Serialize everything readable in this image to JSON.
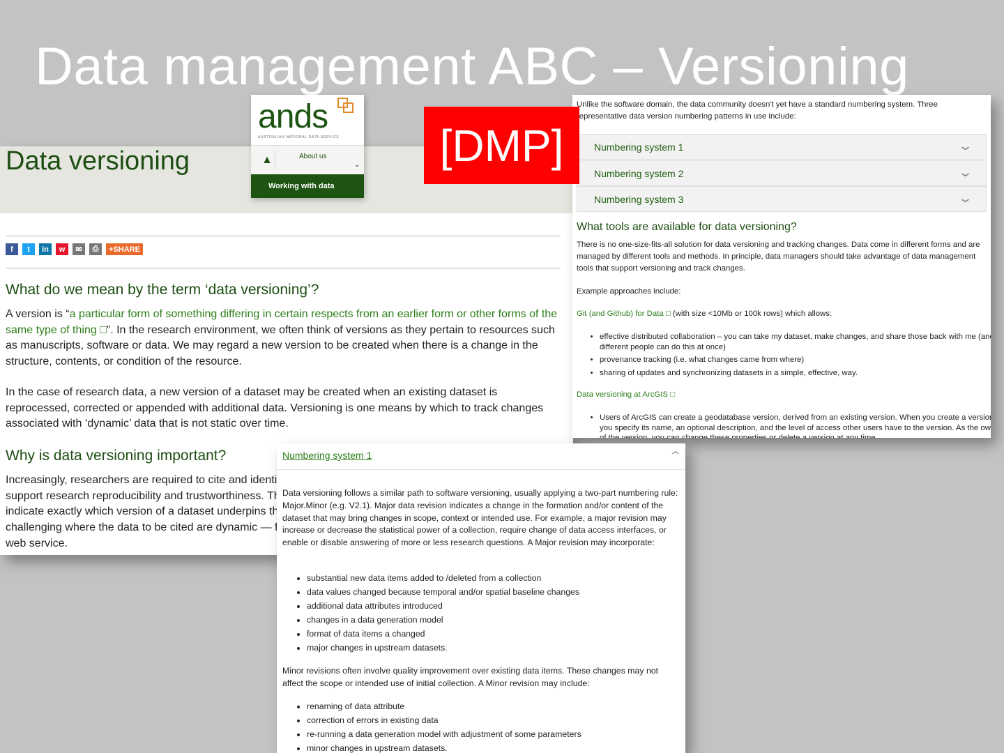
{
  "slide_title": "Data management ABC – Versioning",
  "badge": "[DMP]",
  "left_page": {
    "heading": "Data versioning",
    "share_icons": [
      "facebook-icon",
      "twitter-icon",
      "linkedin-icon",
      "weibo-icon",
      "email-icon",
      "print-icon"
    ],
    "share_label": "SHARE",
    "share_plus": "+",
    "q1": "What do we mean by the term ‘data versioning’?",
    "p1_lead": "A version is “",
    "p1_link": "a particular form of something differing in certain respects from an earlier form or other forms of the same type of thing □",
    "p1_rest": "”. In the research environment, we often think of versions as they pertain to resources such as manuscripts, software or data. We may regard a new version to be created when there is a change in the structure, contents, or condition of the resource.",
    "p2": "In the case of research data, a new version of a dataset may be created when an existing dataset is reprocessed, corrected or appended with additional data. Versioning is one means by which to track changes associated with ‘dynamic’ data that is not static over time.",
    "q2": "Why is data versioning important?",
    "p3": "Increasingly, researchers are required to cite and identify the exact dataset used as a research input in order to support research reproducibility and trustworthiness. This means the researcher needs to be able to accurately indicate exactly which version of a dataset underpins their research findings. This becomes particularly challenging where the data to be cited are dynamic — for example, a subset of a large dataset accessed via a web service."
  },
  "ands": {
    "logo": "ands",
    "tagline": "AUSTRALIAN NATIONAL DATA SERVICE",
    "nav_about": "About us",
    "nav_bar": "Working with data",
    "home_icon": "home-icon"
  },
  "right_page": {
    "intro": "Unlike the software domain, the data community doesn't yet have a standard numbering system. Three representative data version numbering patterns in use include:",
    "accordion": [
      "Numbering system 1",
      "Numbering system 2",
      "Numbering system 3"
    ],
    "tools_heading": "What tools are available for data versioning?",
    "tools_p1": "There is no one-size-fits-all solution for data versioning and tracking changes. Data come in different forms and are managed by different tools and methods. In principle, data managers should take advantage of data management tools that support versioning and track changes.",
    "tools_p2": "Example approaches include:",
    "git_link": "Git (and Github) for Data □",
    "git_rest": " (with size <10Mb or 100k rows) which allows:",
    "git_items": [
      "effective distributed collaboration – you can take my dataset, make changes, and share those back with me (and different people can do this at once)",
      "provenance tracking (i.e. what changes came from where)",
      "sharing of updates and synchronizing datasets in a simple, effective, way."
    ],
    "arcgis_link": "Data versioning at ArcGIS □",
    "arcgis_items": [
      "Users of ArcGIS can create a geodatabase version, derived from an existing version. When you create a version, you specify its name, an optional description, and the level of access other users have to the version. As the owner of the version, you can change these properties or delete a version at any time."
    ]
  },
  "bottom_panel": {
    "title": "Numbering system 1",
    "p1": "Data versioning follows a similar path to software versioning, usually applying a two-part numbering rule: Major.Minor (e.g. V2.1). Major data revision indicates a change in the formation and/or content of the dataset that may bring changes in scope, context or intended use. For example, a major revision may increase or decrease the statistical power of a collection, require change of data access interfaces, or enable or disable answering of more or less research questions. A Major revision may incorporate:",
    "major_items": [
      "substantial new data items added to /deleted from a collection",
      "data values changed because temporal and/or spatial baseline changes",
      "additional data attributes introduced",
      "changes in a data generation model",
      "format of data items a changed",
      "major changes in upstream datasets."
    ],
    "p2": "Minor revisions often involve quality improvement over existing data items. These changes may not affect the scope or intended use of initial collection. A Minor revision may include:",
    "minor_items": [
      "renaming of data attribute",
      "correction of errors in existing data",
      "re-running a data generation model with adjustment of some parameters",
      "minor changes in upstream datasets."
    ]
  }
}
